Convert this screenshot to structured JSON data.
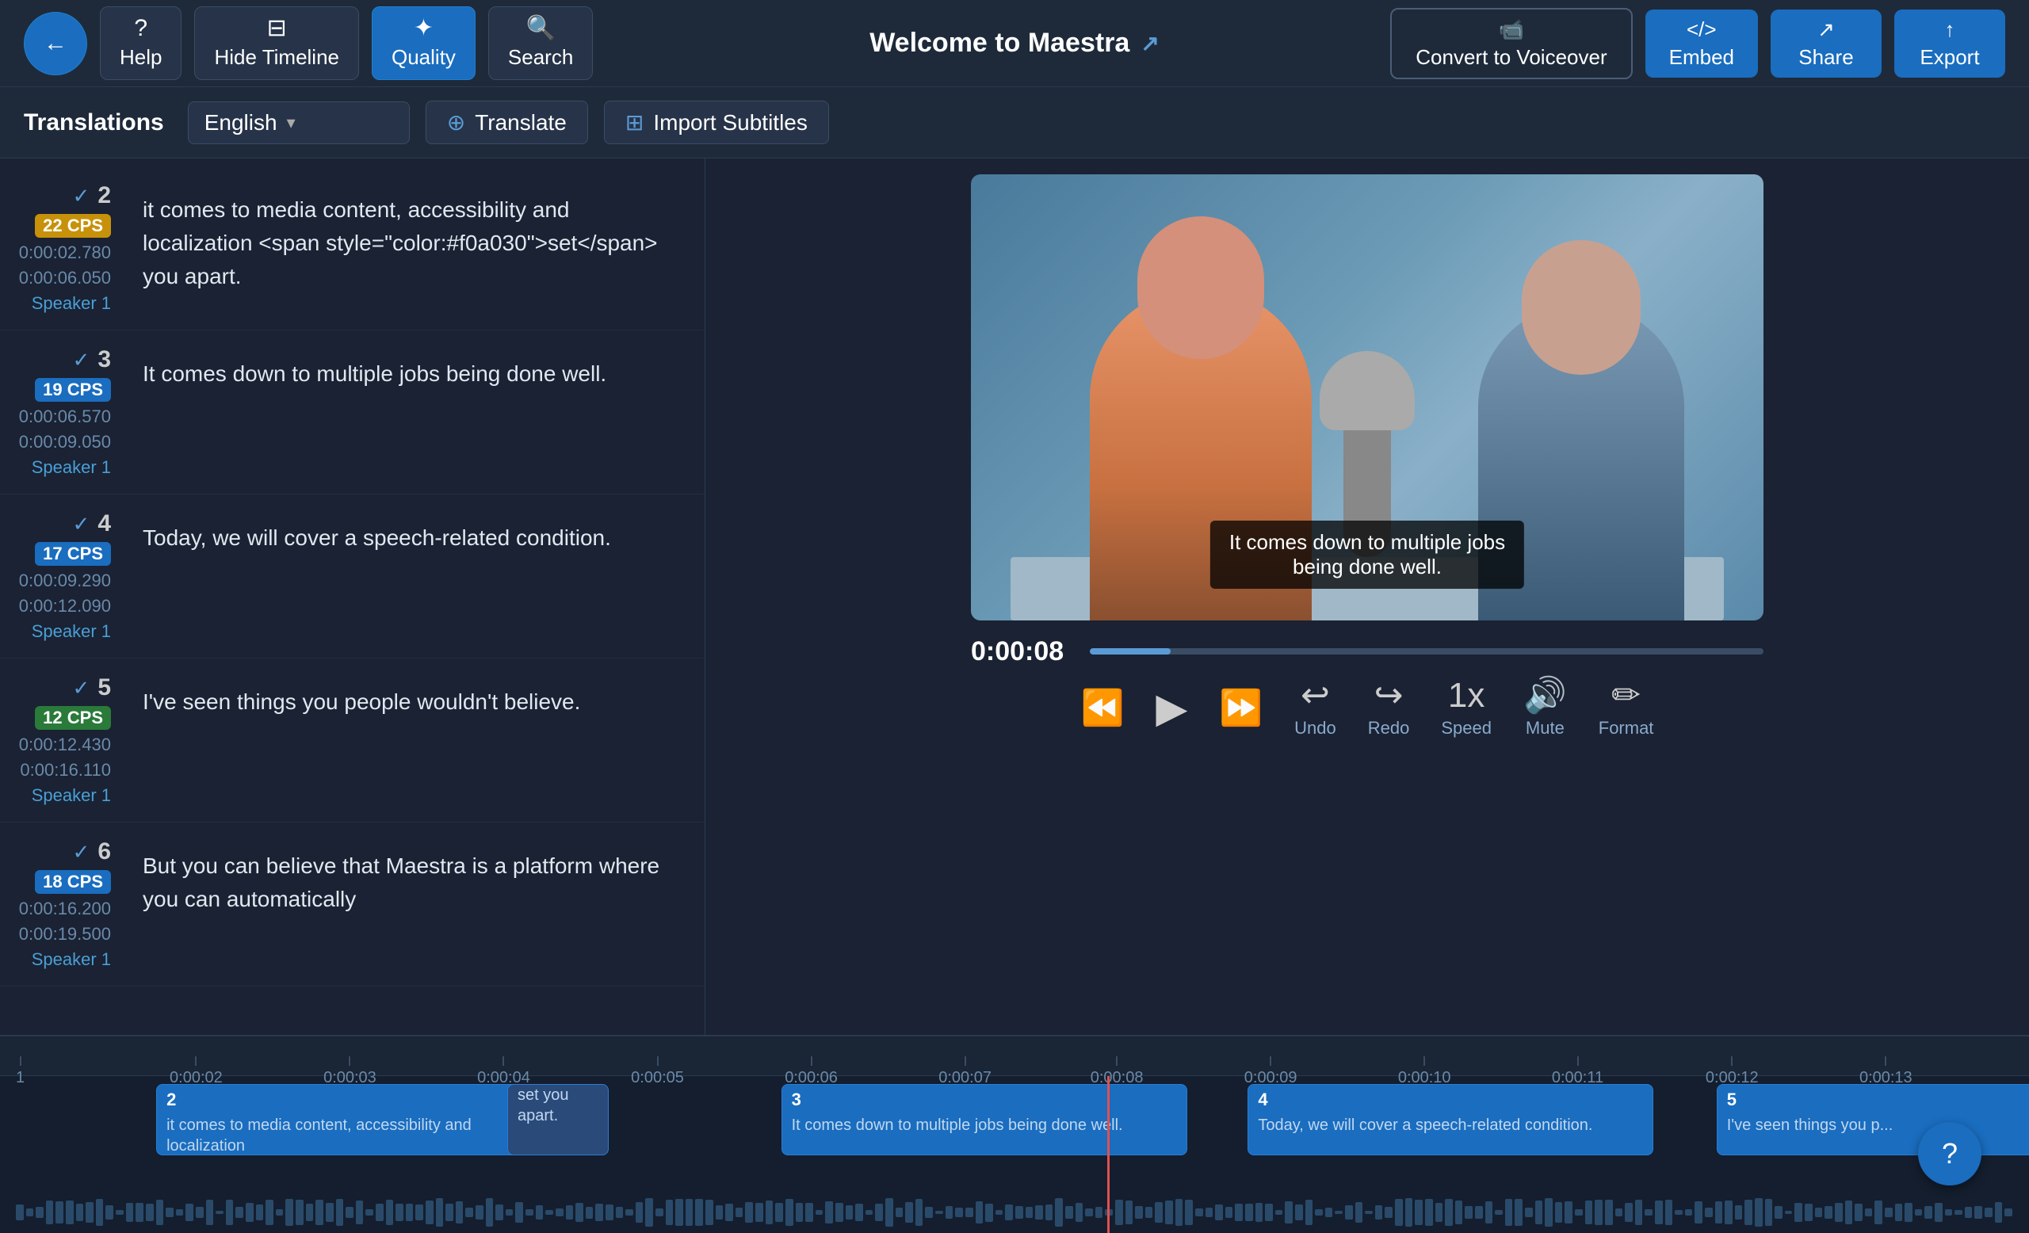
{
  "app": {
    "title": "Welcome to Maestra"
  },
  "toolbar": {
    "back_label": "←",
    "help_label": "Help",
    "hide_timeline_label": "Hide Timeline",
    "quality_label": "Quality",
    "search_label": "Search",
    "convert_label": "Convert to Voiceover",
    "embed_label": "Embed",
    "share_label": "Share",
    "export_label": "Export"
  },
  "subtitle_bar": {
    "translations_label": "Translations",
    "language": "English",
    "translate_label": "Translate",
    "import_label": "Import Subtitles"
  },
  "subtitles": [
    {
      "id": 2,
      "cps": "22 CPS",
      "cps_color": "yellow",
      "time_start": "0:00:02.780",
      "time_end": "0:00:06.050",
      "speaker": "Speaker 1",
      "text": "it comes to media content, accessibility and localization set you apart.",
      "highlight": "set"
    },
    {
      "id": 3,
      "cps": "19 CPS",
      "cps_color": "blue",
      "time_start": "0:00:06.570",
      "time_end": "0:00:09.050",
      "speaker": "Speaker 1",
      "text": "It comes down to multiple jobs being done well.",
      "highlight": null
    },
    {
      "id": 4,
      "cps": "17 CPS",
      "cps_color": "blue",
      "time_start": "0:00:09.290",
      "time_end": "0:00:12.090",
      "speaker": "Speaker 1",
      "text": "Today, we will cover a speech-related condition.",
      "highlight": "will"
    },
    {
      "id": 5,
      "cps": "12 CPS",
      "cps_color": "green",
      "time_start": "0:00:12.430",
      "time_end": "0:00:16.110",
      "speaker": "Speaker 1",
      "text": "I've seen things you people wouldn't believe.",
      "highlight": null
    },
    {
      "id": 6,
      "cps": "18 CPS",
      "cps_color": "blue",
      "time_start": "0:00:16.200",
      "time_end": "0:00:19.500",
      "speaker": "Speaker 1",
      "text": "But you can believe that Maestra is a platform where you can automatically",
      "highlight": null
    }
  ],
  "video": {
    "current_time": "0:00:08",
    "progress_pct": 12,
    "subtitle_overlay": "It comes down to multiple jobs\nbeing done well.",
    "speed_label": "1x",
    "controls": {
      "rewind_label": "",
      "play_label": "",
      "fastforward_label": "",
      "undo_label": "Undo",
      "redo_label": "Redo",
      "speed_label": "Speed",
      "mute_label": "Mute",
      "format_label": "Format"
    }
  },
  "timeline": {
    "ruler_marks": [
      "1",
      "0:00:02",
      "0:00:03",
      "0:00:04",
      "0:00:05",
      "0:00:06",
      "0:00:07",
      "0:00:08",
      "0:00:09",
      "0:00:10",
      "0:00:11",
      "0:00:12",
      "0:00:13"
    ],
    "clips": [
      {
        "id": 2,
        "left_pct": 8,
        "width_pct": 24,
        "text_main": "it comes to media content, accessibility and localization",
        "text_alt": "set you apart."
      },
      {
        "id": 3,
        "left_pct": 33,
        "width_pct": 22,
        "text_main": "It comes down to multiple jobs being done well."
      },
      {
        "id": 4,
        "left_pct": 56,
        "width_pct": 22,
        "text_main": "Today, we will cover a speech-related condition."
      },
      {
        "id": 5,
        "left_pct": 79,
        "width_pct": 20,
        "text_main": "I've seen things you p..."
      }
    ],
    "playhead_pct": 40
  },
  "help_btn": "?"
}
